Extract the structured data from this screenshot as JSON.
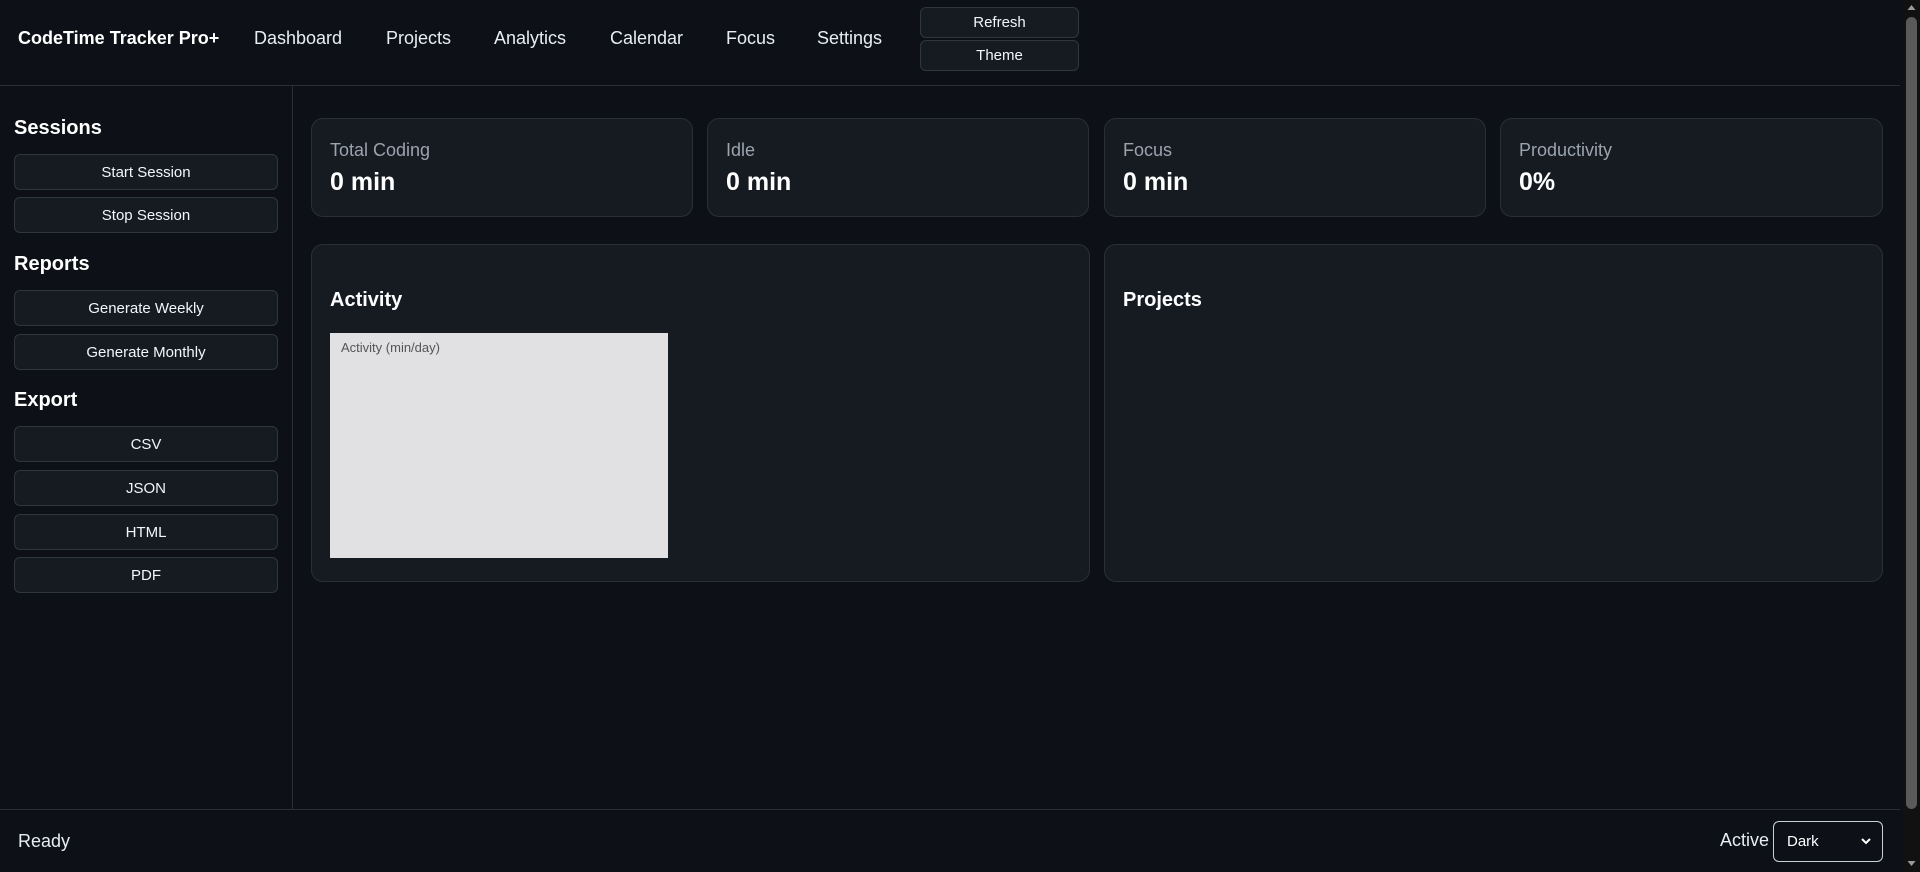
{
  "header": {
    "brand": "CodeTime Tracker Pro+",
    "nav": [
      "Dashboard",
      "Projects",
      "Analytics",
      "Calendar",
      "Focus",
      "Settings"
    ],
    "refresh_label": "Refresh",
    "theme_label": "Theme"
  },
  "sidebar": {
    "sessions_title": "Sessions",
    "start_session": "Start Session",
    "stop_session": "Stop Session",
    "reports_title": "Reports",
    "generate_weekly": "Generate Weekly",
    "generate_monthly": "Generate Monthly",
    "export_title": "Export",
    "export_csv": "CSV",
    "export_json": "JSON",
    "export_html": "HTML",
    "export_pdf": "PDF"
  },
  "stats": [
    {
      "label": "Total Coding",
      "value": "0 min"
    },
    {
      "label": "Idle",
      "value": "0 min"
    },
    {
      "label": "Focus",
      "value": "0 min"
    },
    {
      "label": "Productivity",
      "value": "0%"
    }
  ],
  "panels": {
    "activity_title": "Activity",
    "activity_chart_title": "Activity (min/day)",
    "projects_title": "Projects"
  },
  "footer": {
    "status": "Ready",
    "active_label": "Active",
    "theme_selected": "Dark"
  },
  "colors": {
    "background": "#0d1117",
    "card": "#161b22",
    "border": "#2a2f37",
    "chart_bg": "#e1e1e3"
  }
}
